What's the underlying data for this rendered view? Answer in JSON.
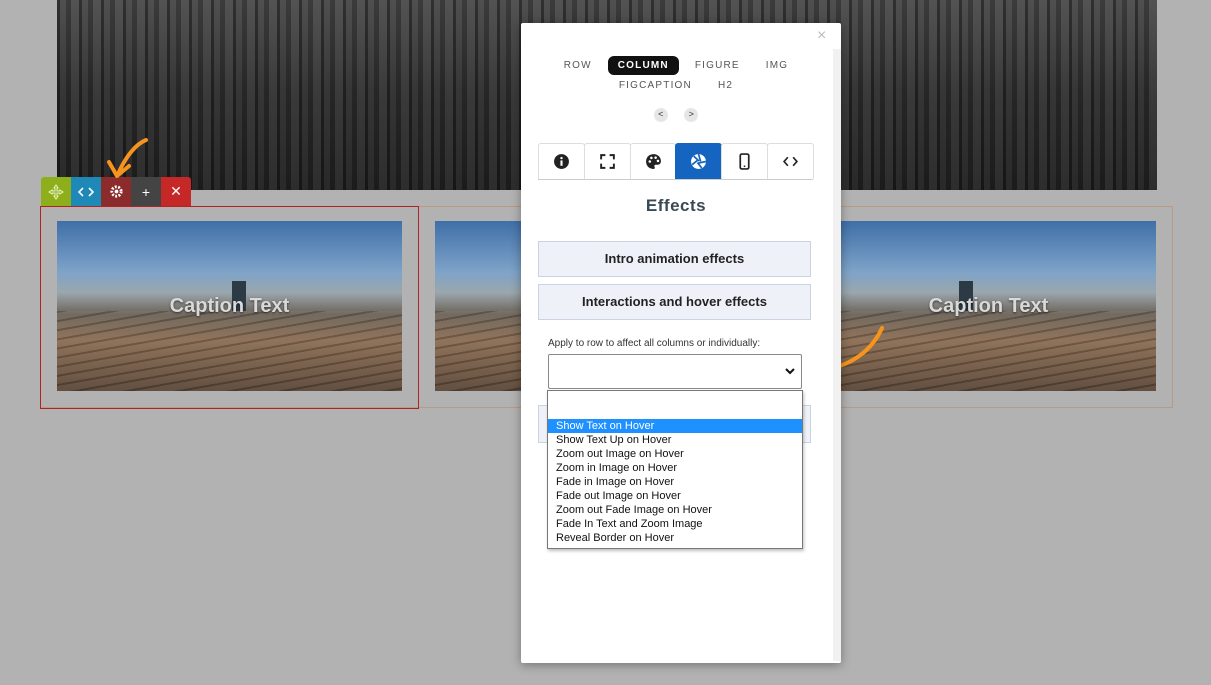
{
  "captions": [
    "Caption Text",
    "Caption Text"
  ],
  "toolbar": {
    "icons": [
      "move-icon",
      "code-icon",
      "gear-icon",
      "plus-icon",
      "close-icon"
    ],
    "add_label": "+",
    "delete_label": "✕"
  },
  "modal": {
    "close_label": "×",
    "breadcrumbs": [
      "ROW",
      "COLUMN",
      "FIGURE",
      "IMG",
      "FIGCAPTION",
      "H2"
    ],
    "active_breadcrumb": "COLUMN",
    "prev_label": "<",
    "next_label": ">",
    "tabs": [
      "info-icon",
      "fullscreen-icon",
      "palette-icon",
      "effects-icon",
      "mobile-icon",
      "code-icon"
    ],
    "active_tab": "effects-icon",
    "section_title": "Effects",
    "buttons": {
      "intro": "Intro animation effects",
      "interactions": "Interactions and hover effects"
    },
    "select_help": "Apply to row to affect all columns or individually:",
    "select_value": ""
  },
  "dropdown": {
    "options": [
      "",
      "Show Text on Hover",
      "Show Text Up on Hover",
      "Zoom out Image on Hover",
      "Zoom in Image on Hover",
      "Fade in Image on Hover",
      "Fade out Image on Hover",
      "Zoom out Fade Image on Hover",
      "Fade In Text and Zoom Image",
      "Reveal Border on Hover"
    ],
    "highlighted": "Show Text on Hover"
  },
  "colors": {
    "accent": "#1565c0",
    "annotation_arrow": "#f7941d",
    "selected_option": "#1e90ff"
  }
}
